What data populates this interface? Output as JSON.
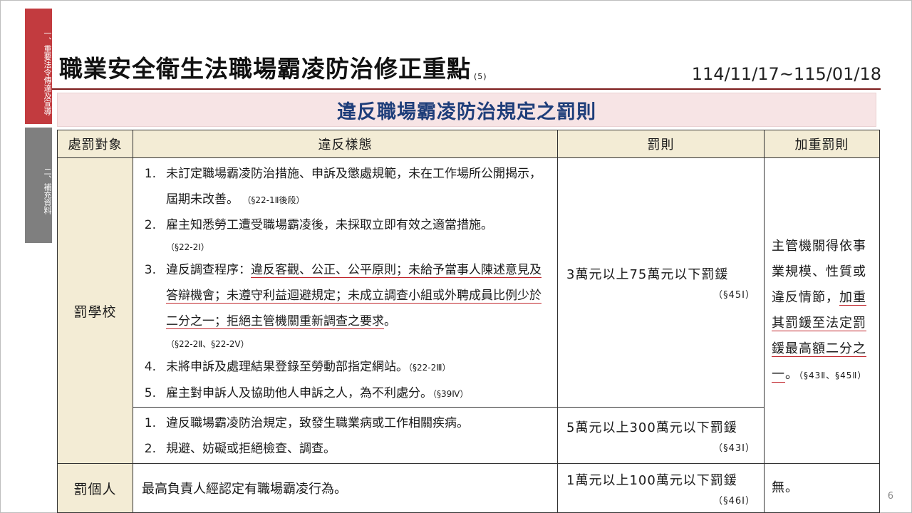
{
  "sidebar": {
    "tab1": "一、重要法令傳達及宣導",
    "tab2": "二、補充資料"
  },
  "header": {
    "title": "職業安全衛生法職場霸凌防治修正重點",
    "title_sup": "(5)",
    "period": "114/11/17~115/01/18",
    "subtitle": "違反職場霸凌防治規定之罰則"
  },
  "table": {
    "headers": [
      "處罰對象",
      "違反樣態",
      "罰則",
      "加重罰則"
    ],
    "row_school": {
      "target": "罰學校",
      "group1": {
        "item1_num": "1.",
        "item1_text": "未訂定職場霸凌防治措施、申訴及懲處規範，未在工作場所公開揭示，屆期未改善。",
        "item1_ref": "（§22-1Ⅱ後段）",
        "item2_num": "2.",
        "item2_text": "雇主知悉勞工遭受職場霸凌後，未採取立即有效之適當措施。",
        "item2_ref": "（§22-2Ⅰ）",
        "item3_num": "3.",
        "item3_prefix": "違反調查程序：",
        "item3_underlined": "違反客觀、公正、公平原則；未給予當事人陳述意見及答辯機會；未遵守利益迴避規定；未成立調查小組或外聘成員比例少於二分之一；拒絕主管機關重新調查之要求",
        "item3_suffix": "。",
        "item3_ref": "（§22-2Ⅱ、§22-2Ⅴ）",
        "item4_num": "4.",
        "item4_text": "未將申訴及處理結果登錄至勞動部指定網站。",
        "item4_ref": "（§22-2Ⅲ）",
        "item5_num": "5.",
        "item5_text": "雇主對申訴人及協助他人申訴之人，為不利處分。",
        "item5_ref": "（§39Ⅳ）",
        "penalty": "3萬元以上75萬元以下罰鍰",
        "penalty_ref": "（§45Ⅰ）"
      },
      "group2": {
        "item1_num": "1.",
        "item1_text": "違反職場霸凌防治規定，致發生職業病或工作相關疾病。",
        "item2_num": "2.",
        "item2_text": "規避、妨礙或拒絕檢查、調查。",
        "penalty": "5萬元以上300萬元以下罰鍰",
        "penalty_ref": "（§43Ⅰ）"
      },
      "extra_prefix": "主管機關得依事業規模、性質或違反情節，",
      "extra_underlined": "加重其罰鍰至法定罰鍰最高額二分之一",
      "extra_suffix": "。",
      "extra_ref": "（§43Ⅱ、§45Ⅱ）"
    },
    "row_person": {
      "target": "罰個人",
      "text": "最高負責人經認定有職場霸凌行為。",
      "penalty": "1萬元以上100萬元以下罰鍰",
      "penalty_ref": "（§46Ⅰ）",
      "extra": "無。"
    }
  },
  "page_number": "6"
}
